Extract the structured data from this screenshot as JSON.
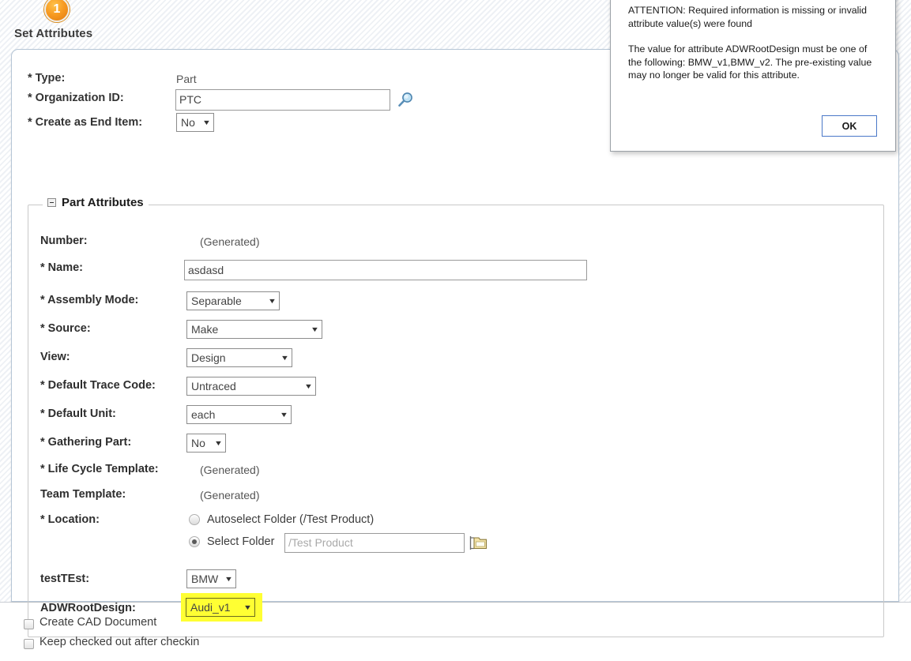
{
  "step": {
    "number": "1",
    "title": "Set Attributes"
  },
  "top_fields": {
    "type": {
      "label": "* Type:",
      "value": "Part"
    },
    "organization_id": {
      "label": "* Organization ID:",
      "value": "PTC",
      "icon": "search-icon"
    },
    "create_as_end_item": {
      "label": "* Create as End Item:",
      "value": "No"
    }
  },
  "fieldset": {
    "title": "Part Attributes",
    "toggle_icon": "collapse-minus-icon",
    "fields": {
      "number": {
        "label": "Number:",
        "value": "(Generated)"
      },
      "name": {
        "label": "* Name:",
        "value": "asdasd"
      },
      "assembly_mode": {
        "label": "* Assembly Mode:",
        "value": "Separable"
      },
      "source": {
        "label": "* Source:",
        "value": "Make"
      },
      "view": {
        "label": "View:",
        "value": "Design"
      },
      "default_trace_code": {
        "label": "* Default Trace Code:",
        "value": "Untraced"
      },
      "default_unit": {
        "label": "* Default Unit:",
        "value": "each"
      },
      "gathering_part": {
        "label": "* Gathering Part:",
        "value": "No"
      },
      "life_cycle_template": {
        "label": "* Life Cycle Template:",
        "value": "(Generated)"
      },
      "team_template": {
        "label": "Team Template:",
        "value": "(Generated)"
      },
      "location": {
        "label": "* Location:",
        "option_autoselect": "Autoselect Folder (/Test Product)",
        "option_select": "Select Folder",
        "selected": "select_folder",
        "folder_value": "",
        "folder_placeholder": "/Test Product",
        "browse_icon": "folder-browse-icon"
      },
      "test_test": {
        "label": "testTEst:",
        "value": "BMW"
      },
      "adw_root_design": {
        "label": "ADWRootDesign:",
        "value": "Audi_v1",
        "highlight_color": "#ffff33"
      }
    }
  },
  "checkboxes": [
    {
      "label": "Create CAD Document",
      "checked": false
    },
    {
      "label": "Keep checked out after checkin",
      "checked": false
    }
  ],
  "dialog": {
    "paragraph1": "ATTENTION: Required information is missing or invalid attribute value(s) were found",
    "paragraph2": "The value for attribute ADWRootDesign must be one of the following: BMW_v1,BMW_v2. The pre-existing value may no longer be valid for this attribute.",
    "ok_label": "OK"
  }
}
